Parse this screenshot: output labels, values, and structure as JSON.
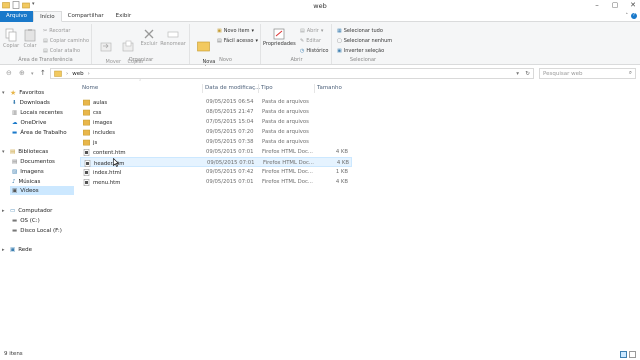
{
  "window": {
    "title": "web",
    "controls": [
      "–",
      "▢",
      "✕"
    ]
  },
  "ribbon_tabs": [
    {
      "label": "Arquivo"
    },
    {
      "label": "Início"
    },
    {
      "label": "Compartilhar"
    },
    {
      "label": "Exibir"
    }
  ],
  "ribbon": {
    "clipboard": {
      "label": "Área de Transferência",
      "copy": "Copiar",
      "paste": "Colar",
      "cut": "Recortar",
      "copy_path": "Copiar caminho",
      "paste_shortcut": "Colar atalho"
    },
    "organize": {
      "label": "Organizar",
      "move_to": "Mover\npara",
      "copy_to": "Copiar\npara",
      "delete": "Excluir",
      "rename": "Renomear"
    },
    "new": {
      "label": "Novo",
      "new_folder": "Nova\npasta",
      "new_item": "Novo item",
      "easy_access": "Fácil acesso"
    },
    "open": {
      "label": "Abrir",
      "properties": "Propriedades",
      "open": "Abrir",
      "edit": "Editar",
      "history": "Histórico"
    },
    "select": {
      "label": "Selecionar",
      "select_all": "Selecionar tudo",
      "select_none": "Selecionar nenhum",
      "invert": "Inverter seleção"
    }
  },
  "address": {
    "path": [
      "web"
    ],
    "search_placeholder": "Pesquisar web"
  },
  "nav": {
    "favorites": {
      "label": "Favoritos",
      "items": [
        "Downloads",
        "Locais recentes",
        "OneDrive",
        "Área de Trabalho"
      ]
    },
    "libraries": {
      "label": "Bibliotecas",
      "items": [
        "Documentos",
        "Imagens",
        "Músicas",
        "Vídeos"
      ]
    },
    "computer": {
      "label": "Computador",
      "items": [
        "OS (C:)",
        "Disco Local (F:)"
      ]
    },
    "network": {
      "label": "Rede"
    }
  },
  "columns": {
    "name": "Nome",
    "date": "Data de modificaç...",
    "type": "Tipo",
    "size": "Tamanho"
  },
  "files": [
    {
      "name": "aulas",
      "date": "09/05/2015 06:54",
      "type": "Pasta de arquivos",
      "size": "",
      "kind": "folder"
    },
    {
      "name": "css",
      "date": "08/05/2015 21:47",
      "type": "Pasta de arquivos",
      "size": "",
      "kind": "folder"
    },
    {
      "name": "images",
      "date": "07/05/2015 15:04",
      "type": "Pasta de arquivos",
      "size": "",
      "kind": "folder"
    },
    {
      "name": "includes",
      "date": "09/05/2015 07:20",
      "type": "Pasta de arquivos",
      "size": "",
      "kind": "folder"
    },
    {
      "name": "js",
      "date": "09/05/2015 07:38",
      "type": "Pasta de arquivos",
      "size": "",
      "kind": "folder"
    },
    {
      "name": "content.htm",
      "date": "09/05/2015 07:01",
      "type": "Firefox HTML Doc...",
      "size": "4 KB",
      "kind": "file"
    },
    {
      "name": "header.htm",
      "date": "09/05/2015 07:01",
      "type": "Firefox HTML Doc...",
      "size": "4 KB",
      "kind": "file"
    },
    {
      "name": "index.html",
      "date": "09/05/2015 07:42",
      "type": "Firefox HTML Doc...",
      "size": "1 KB",
      "kind": "file"
    },
    {
      "name": "menu.htm",
      "date": "09/05/2015 07:01",
      "type": "Firefox HTML Doc...",
      "size": "4 KB",
      "kind": "file"
    }
  ],
  "status": {
    "item_count": "9 itens"
  },
  "colors": {
    "accent": "#1979ca",
    "folder": "#e8b64a",
    "selection": "#cce8ff"
  }
}
